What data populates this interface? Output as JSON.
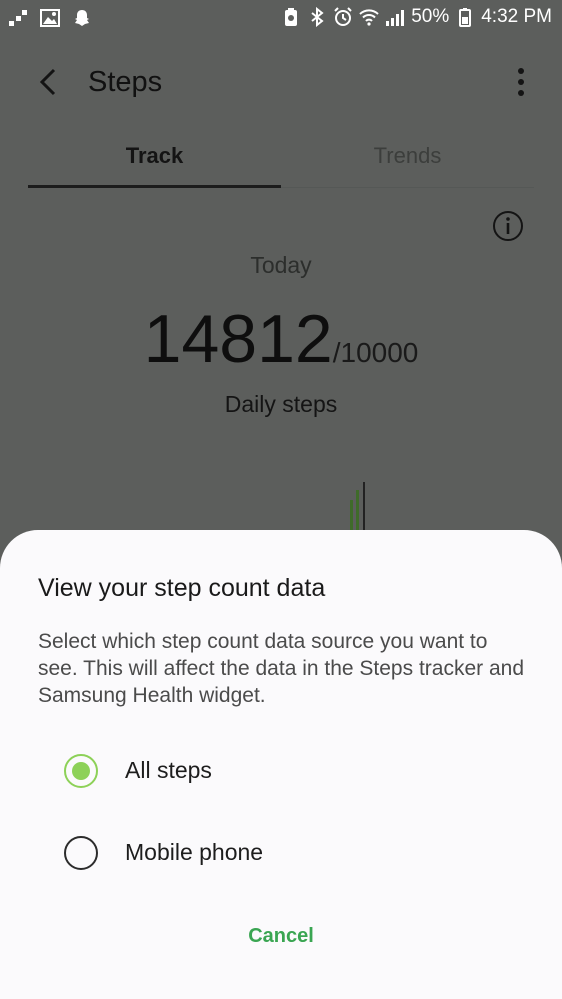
{
  "status_bar": {
    "battery": "50%",
    "time": "4:32 PM",
    "left_icons": [
      "signal-dots-icon",
      "image-icon",
      "snapchat-icon"
    ],
    "right_icons": [
      "battery-saver-icon",
      "bluetooth-icon",
      "alarm-icon",
      "wifi-icon",
      "cell-signal-icon",
      "battery-icon"
    ]
  },
  "app_bar": {
    "title": "Steps"
  },
  "tabs": [
    {
      "label": "Track",
      "selected": true
    },
    {
      "label": "Trends",
      "selected": false
    }
  ],
  "summary": {
    "period": "Today",
    "steps": "14812",
    "goal": "/10000",
    "label": "Daily steps"
  },
  "bottom_sheet": {
    "title": "View your step count data",
    "description": "Select which step count data source you want to see. This will affect the data in the Steps tracker and Samsung Health widget.",
    "options": [
      {
        "label": "All steps",
        "selected": true
      },
      {
        "label": "Mobile phone",
        "selected": false
      }
    ],
    "cancel_label": "Cancel"
  },
  "colors": {
    "accent_green": "#8dd158",
    "cancel_green": "#3aa552",
    "scrim": "#5c5e5c",
    "sheet_bg": "#fbfafc"
  }
}
